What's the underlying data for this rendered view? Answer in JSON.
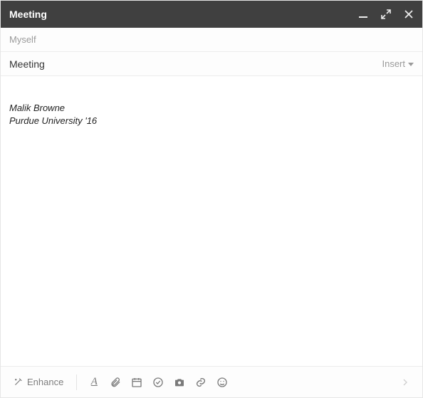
{
  "titlebar": {
    "title": "Meeting"
  },
  "recipients": {
    "to_display": "Myself"
  },
  "subject": {
    "value": "Meeting"
  },
  "insert": {
    "label": "Insert"
  },
  "body": {
    "signature_line1": "Malik Browne",
    "signature_line2": "Purdue University '16"
  },
  "toolbar": {
    "enhance_label": "Enhance",
    "icons": {
      "font": "font-format-icon",
      "attach": "paperclip-icon",
      "calendar": "calendar-icon",
      "task": "check-circle-icon",
      "photo": "camera-icon",
      "link": "link-icon",
      "emoji": "smile-icon"
    }
  }
}
